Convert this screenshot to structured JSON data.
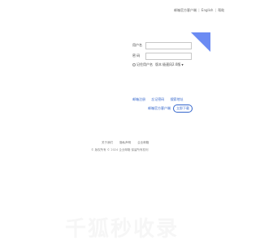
{
  "top_links": {
    "client": "邮箱官方客户端",
    "english": "English",
    "help": "帮助",
    "separator": "|"
  },
  "login": {
    "username_label": "用户名",
    "username_value": "",
    "password_label": "密  码",
    "password_value": "",
    "remember_label": "记住用户名",
    "version_label": "版本",
    "version_value": "极速风2.0版"
  },
  "links": {
    "register": "邮箱注册",
    "forgot": "忘记密码",
    "search": "搜索地址",
    "client_download": "邮箱官方客户端",
    "download_button": "立即下载"
  },
  "footer": {
    "about": "关于我们",
    "privacy": "隐私声明",
    "enterprise": "企业邮箱",
    "copyright": "© 版权所有 © 2024 企业邮箱 保留所有权利"
  },
  "watermark": "千狐秒收录",
  "colors": {
    "accent": "#3466cc",
    "corner": "#6b8bf3"
  }
}
